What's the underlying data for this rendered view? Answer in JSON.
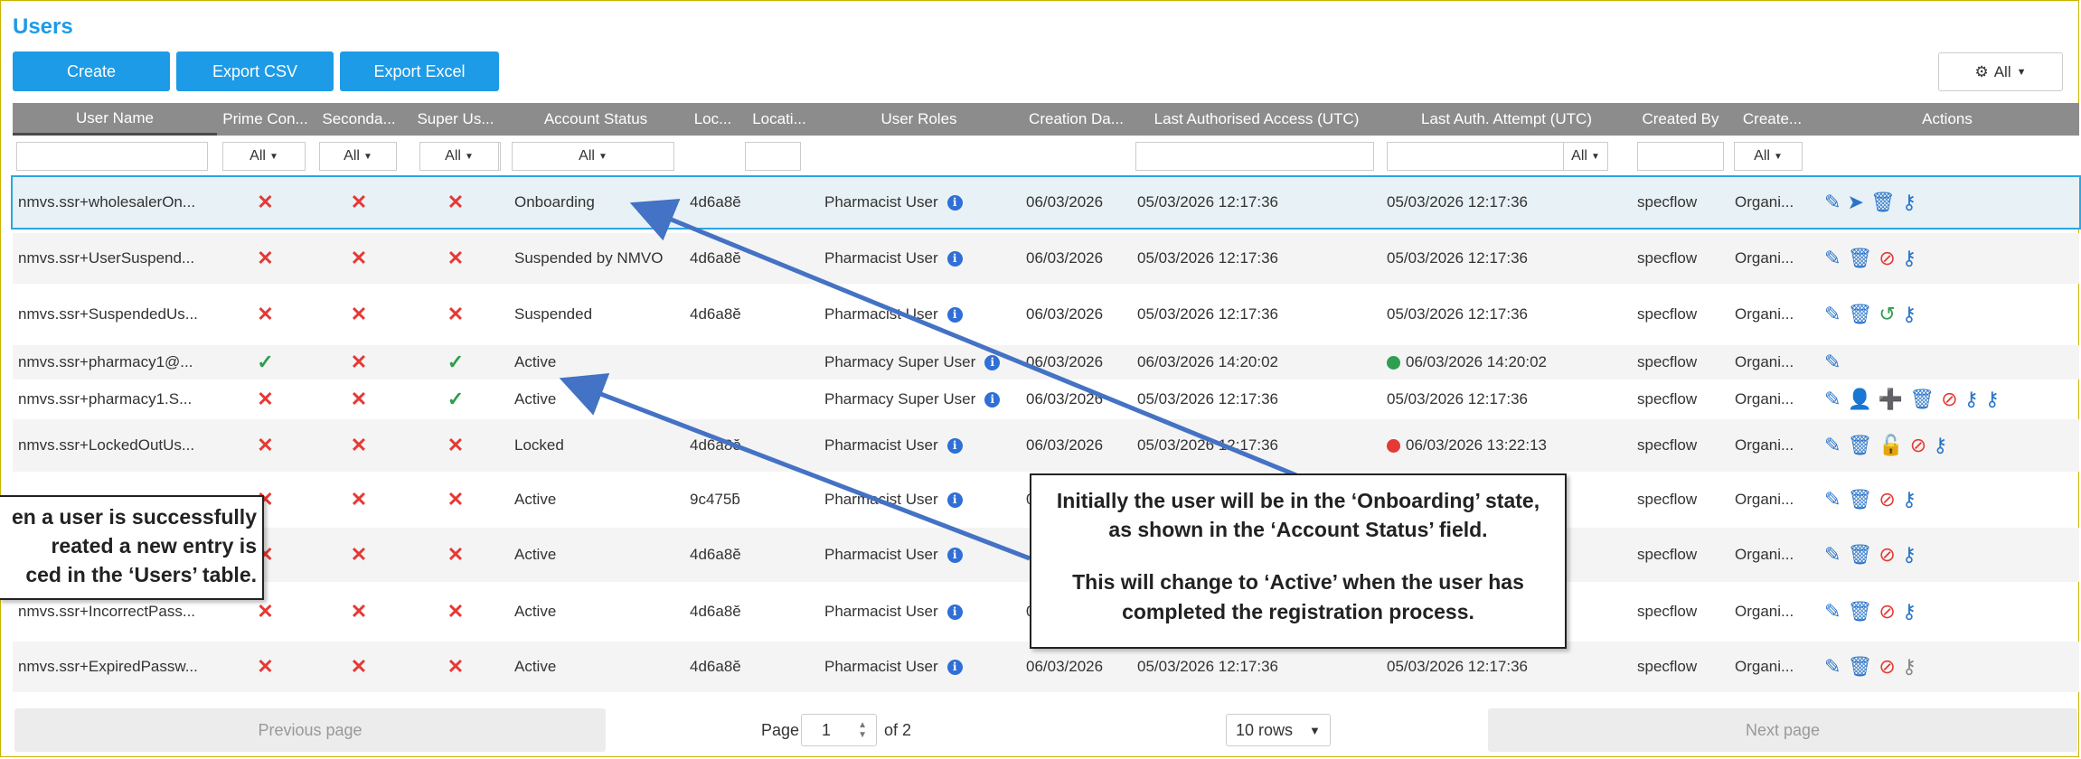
{
  "page": {
    "title": "Users"
  },
  "toolbar": {
    "create_label": "Create",
    "export_csv_label": "Export CSV",
    "export_excel_label": "Export Excel",
    "columns_filter_label": "All"
  },
  "columns": [
    "User Name",
    "Prime Con...",
    "Seconda...",
    "Super Us...",
    "Account Status",
    "Loc...",
    "Locati...",
    "User Roles",
    "Creation Da...",
    "Last Authorised Access (UTC)",
    "Last Auth. Attempt (UTC)",
    "Created By",
    "Create...",
    "Actions"
  ],
  "filters": {
    "all_label": "All"
  },
  "rows": [
    {
      "user": "nmvs.ssr+wholesalerOn...",
      "prime": "x",
      "secondary": "x",
      "super": "x",
      "status": "Onboarding",
      "loc": "4d6a8ĕ",
      "role": "Pharmacist User",
      "created": "06/03/2026",
      "last_access": "05/03/2026 12:17:36",
      "last_attempt": "05/03/2026 12:17:36",
      "attempt_dot": "",
      "created_by": "specflow",
      "creator": "Organi...",
      "actions": [
        "pencil-icon",
        "send-icon",
        "trash-icon",
        "key-icon"
      ]
    },
    {
      "user": "nmvs.ssr+UserSuspend...",
      "prime": "x",
      "secondary": "x",
      "super": "x",
      "status": "Suspended by NMVO",
      "loc": "4d6a8ĕ",
      "role": "Pharmacist User",
      "created": "06/03/2026",
      "last_access": "05/03/2026 12:17:36",
      "last_attempt": "05/03/2026 12:17:36",
      "attempt_dot": "",
      "created_by": "specflow",
      "creator": "Organi...",
      "actions": [
        "pencil-icon",
        "trash-icon",
        "ban-icon",
        "key-icon"
      ]
    },
    {
      "user": "nmvs.ssr+SuspendedUs...",
      "prime": "x",
      "secondary": "x",
      "super": "x",
      "status": "Suspended",
      "loc": "4d6a8ĕ",
      "role": "Pharmacist User",
      "created": "06/03/2026",
      "last_access": "05/03/2026 12:17:36",
      "last_attempt": "05/03/2026 12:17:36",
      "attempt_dot": "",
      "created_by": "specflow",
      "creator": "Organi...",
      "actions": [
        "pencil-icon",
        "trash-icon",
        "restore-icon",
        "key-icon"
      ]
    },
    {
      "user": "nmvs.ssr+pharmacy1@...",
      "prime": "check",
      "secondary": "x",
      "super": "check",
      "status": "Active",
      "loc": "",
      "role": "Pharmacy Super User",
      "created": "06/03/2026",
      "last_access": "06/03/2026 14:20:02",
      "last_attempt": "06/03/2026 14:20:02",
      "attempt_dot": "#2e9e4f",
      "created_by": "specflow",
      "creator": "Organi...",
      "actions": [
        "pencil-icon"
      ]
    },
    {
      "user": "nmvs.ssr+pharmacy1.S...",
      "prime": "x",
      "secondary": "x",
      "super": "check",
      "status": "Active",
      "loc": "",
      "role": "Pharmacy Super User",
      "created": "06/03/2026",
      "last_access": "05/03/2026 12:17:36",
      "last_attempt": "05/03/2026 12:17:36",
      "attempt_dot": "",
      "created_by": "specflow",
      "creator": "Organi...",
      "actions": [
        "pencil-icon",
        "user-icon",
        "add-user-icon",
        "trash-icon",
        "ban-icon",
        "key-icon",
        "key-icon"
      ]
    },
    {
      "user": "nmvs.ssr+LockedOutUs...",
      "prime": "x",
      "secondary": "x",
      "super": "x",
      "status": "Locked",
      "loc": "4d6a8ĕ",
      "role": "Pharmacist User",
      "created": "06/03/2026",
      "last_access": "05/03/2026 12:17:36",
      "last_attempt": "06/03/2026 13:22:13",
      "attempt_dot": "#e53935",
      "created_by": "specflow",
      "creator": "Organi...",
      "actions": [
        "pencil-icon",
        "trash-icon",
        "unlock-icon",
        "ban-icon",
        "key-icon"
      ]
    },
    {
      "user": "",
      "prime": "x",
      "secondary": "x",
      "super": "x",
      "status": "Active",
      "loc": "9c475ƃ",
      "role": "Pharmacist User",
      "created": "06",
      "last_access": "",
      "last_attempt": "",
      "attempt_dot": "",
      "created_by": "specflow",
      "creator": "Organi...",
      "actions": [
        "pencil-icon",
        "trash-icon",
        "ban-icon",
        "key-icon"
      ]
    },
    {
      "user": "",
      "prime": "x",
      "secondary": "x",
      "super": "x",
      "status": "Active",
      "loc": "4d6a8ĕ",
      "role": "Pharmacist User",
      "created": "",
      "last_access": "",
      "last_attempt": "",
      "attempt_dot": "",
      "created_by": "specflow",
      "creator": "Organi...",
      "actions": [
        "pencil-icon",
        "trash-icon",
        "ban-icon",
        "key-icon"
      ]
    },
    {
      "user": "nmvs.ssr+IncorrectPass...",
      "prime": "x",
      "secondary": "x",
      "super": "x",
      "status": "Active",
      "loc": "4d6a8ĕ",
      "role": "Pharmacist User",
      "created": "06",
      "last_access": "",
      "last_attempt": "",
      "attempt_dot": "",
      "created_by": "specflow",
      "creator": "Organi...",
      "actions": [
        "pencil-icon",
        "trash-icon",
        "ban-icon",
        "key-icon"
      ]
    },
    {
      "user": "nmvs.ssr+ExpiredPassw...",
      "prime": "x",
      "secondary": "x",
      "super": "x",
      "status": "Active",
      "loc": "4d6a8ĕ",
      "role": "Pharmacist User",
      "created": "06/03/2026",
      "last_access": "05/03/2026 12:17:36",
      "last_attempt": "05/03/2026 12:17:36",
      "attempt_dot": "",
      "created_by": "specflow",
      "creator": "Organi...",
      "actions": [
        "pencil-icon",
        "trash-icon",
        "ban-icon",
        "key-gray-icon"
      ]
    }
  ],
  "pagination": {
    "previous_label": "Previous page",
    "page_label": "Page",
    "page_value": "1",
    "of_label": "of 2",
    "rows_label": "10 rows",
    "next_label": "Next page"
  },
  "callouts": {
    "left": [
      "en a user is successfully",
      "reated a new entry is",
      "ced in the ‘Users’ table."
    ],
    "right": [
      "Initially the user will be in the ‘Onboarding’ state, as shown in the ‘Account Status’ field.",
      "This will change to ‘Active’ when the user has completed the registration process."
    ]
  },
  "colors": {
    "accent": "#1d9be6",
    "header": "#8c8c8c",
    "x": "#e53935",
    "check": "#2e9e4f",
    "action": "#2b75c9",
    "arrow": "#4472c4"
  }
}
